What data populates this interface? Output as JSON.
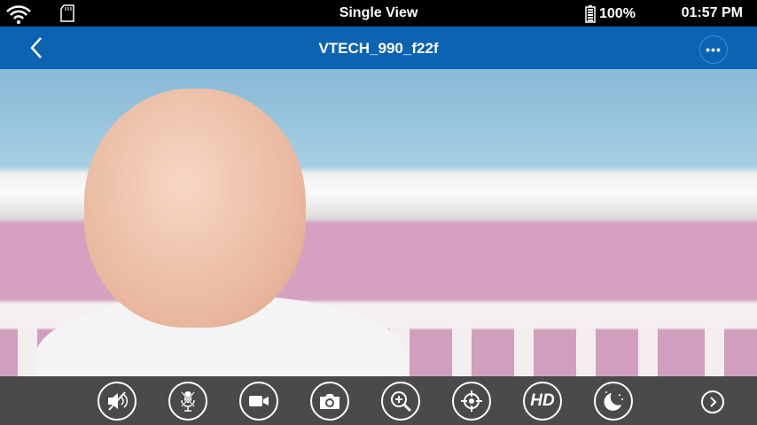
{
  "status_bar": {
    "title": "Single View",
    "battery": "100%",
    "time": "01:57 PM",
    "icons": [
      "wifi-icon",
      "sd-card-icon",
      "battery-icon"
    ]
  },
  "header": {
    "device_name": "VTECH_990_f22f",
    "back_icon": "chevron-left-icon",
    "menu_icon": "more-horizontal-icon",
    "menu_glyph": "•••"
  },
  "toolbar": {
    "hd_label": "HD",
    "buttons": [
      "speaker-mute",
      "microphone-mute",
      "record-video",
      "snapshot",
      "zoom-in",
      "pan-tilt-target",
      "hd-quality",
      "night-mode",
      "next"
    ]
  },
  "colors": {
    "header": "#0b63b2",
    "toolbar": "#4a4a4a"
  }
}
